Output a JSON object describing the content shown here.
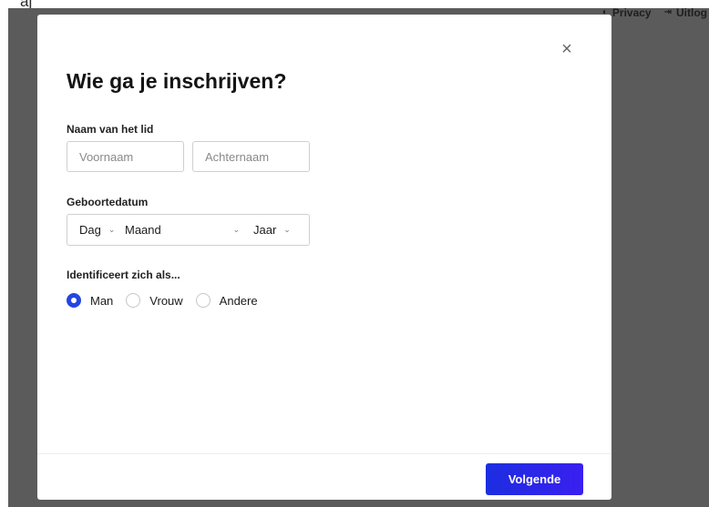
{
  "background": {
    "strip_text": "aj",
    "nav": {
      "privacy_label": "Privacy",
      "logout_label": "Uitlog"
    }
  },
  "modal": {
    "close_glyph": "×",
    "title": "Wie ga je inschrijven?",
    "name_section": {
      "label": "Naam van het lid",
      "first_name_placeholder": "Voornaam",
      "last_name_placeholder": "Achternaam"
    },
    "dob_section": {
      "label": "Geboortedatum",
      "day_value": "Dag",
      "month_value": "Maand",
      "year_value": "Jaar",
      "chevron": "⌄"
    },
    "gender_section": {
      "label": "Identificeert zich als...",
      "options": [
        {
          "label": "Man",
          "selected": true
        },
        {
          "label": "Vrouw",
          "selected": false
        },
        {
          "label": "Andere",
          "selected": false
        }
      ]
    },
    "next_button": "Volgende"
  },
  "colors": {
    "accent": "#2546e0",
    "backdrop": "#5b5b5b"
  }
}
